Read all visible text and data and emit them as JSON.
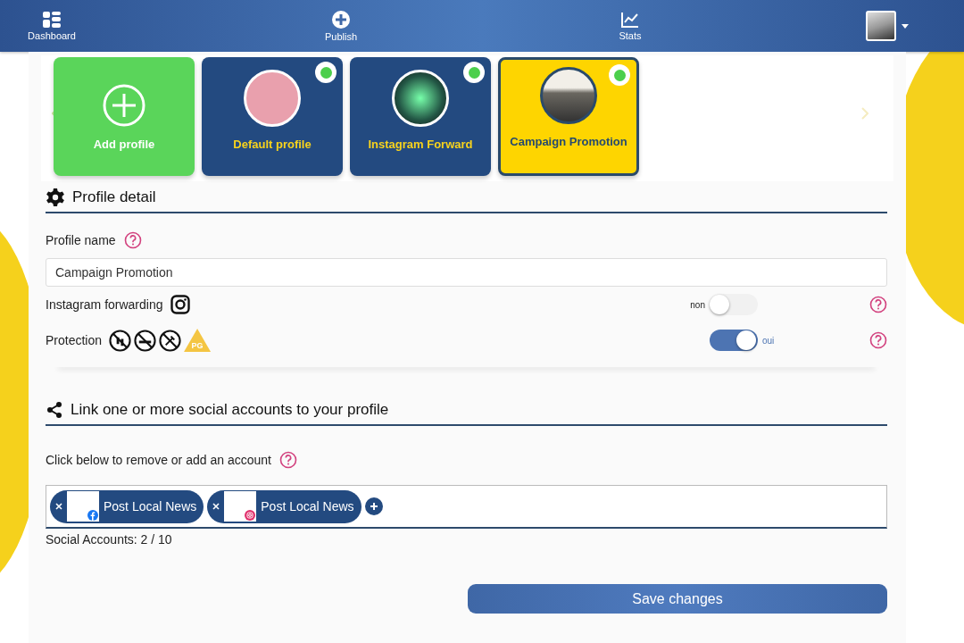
{
  "nav": {
    "items": [
      {
        "label": "Dashboard"
      },
      {
        "label": "Publish"
      },
      {
        "label": "Stats"
      }
    ]
  },
  "profiles": [
    {
      "kind": "add",
      "label": "Add profile"
    },
    {
      "kind": "profile",
      "label": "Default profile",
      "selected": false,
      "active": true
    },
    {
      "kind": "profile",
      "label": "Instagram Forward",
      "selected": false,
      "active": true
    },
    {
      "kind": "profile",
      "label": "Campaign Promotion",
      "selected": true,
      "active": true
    }
  ],
  "detail": {
    "title": "Profile detail",
    "name_label": "Profile name",
    "name_value": "Campaign Promotion",
    "toggles": [
      {
        "kind": "instagram",
        "label": "Instagram forwarding",
        "on": false,
        "reading": "non"
      },
      {
        "kind": "protection",
        "label": "Protection",
        "on": true,
        "reading": "oui",
        "rating": "PG"
      }
    ]
  },
  "social": {
    "title": "Link one or more social accounts to your profile",
    "hint": "Click below to remove or add an account",
    "accounts": [
      {
        "kind": "facebook",
        "name": "Post Local News"
      },
      {
        "kind": "instagram",
        "name": "Post Local News"
      }
    ],
    "count": "Social Accounts: 2 / 10"
  },
  "save": "Save changes"
}
